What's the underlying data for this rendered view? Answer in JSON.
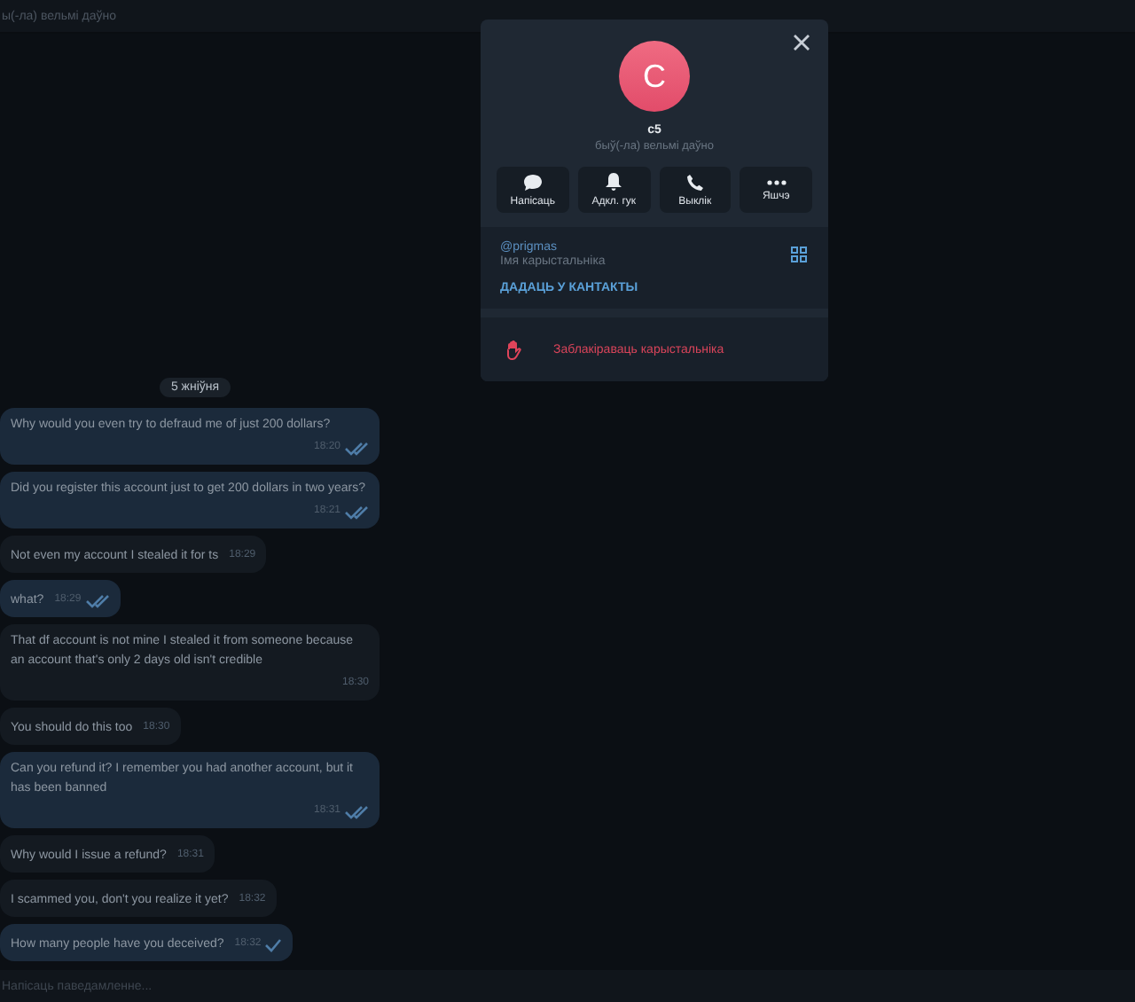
{
  "header": {
    "status": "ы(-ла) вельмі даўно"
  },
  "date_chip": "5 жніўня",
  "messages": [
    {
      "text": "Why would you even try to defraud me of just 200 dollars?",
      "time": "18:20",
      "outgoing": true,
      "read": true
    },
    {
      "text": "Did you register this account just to get 200 dollars in two years?",
      "time": "18:21",
      "outgoing": true,
      "read": true
    },
    {
      "text": "Not even my account I stealed it for ts",
      "time": "18:29",
      "outgoing": false
    },
    {
      "text": "what?",
      "time": "18:29",
      "outgoing": true,
      "read": true
    },
    {
      "text": "That df account is not mine I stealed it from someone because an account that's only 2 days old isn't credible",
      "time": "18:30",
      "outgoing": false
    },
    {
      "text": "You should do this too",
      "time": "18:30",
      "outgoing": false
    },
    {
      "text": "Can you refund it? I remember you had another account, but it has been banned",
      "time": "18:31",
      "outgoing": true,
      "read": true
    },
    {
      "text": "Why would I issue a refund?",
      "time": "18:31",
      "outgoing": false
    },
    {
      "text": "I scammed you, don't you realize it yet?",
      "time": "18:32",
      "outgoing": false
    },
    {
      "text": "How many people have you deceived?",
      "time": "18:32",
      "outgoing": true,
      "read": false
    }
  ],
  "composer": {
    "placeholder": "Напісаць паведамленне..."
  },
  "profile": {
    "avatar_letter": "C",
    "name": "c5",
    "status": "быў(-ла) вельмі даўно",
    "actions": [
      {
        "kind": "message",
        "label": "Напісаць"
      },
      {
        "kind": "bell",
        "label": "Адкл. гук"
      },
      {
        "kind": "call",
        "label": "Выклік"
      },
      {
        "kind": "more",
        "label": "Яшчэ"
      }
    ],
    "username": "@prigmas",
    "username_caption": "Імя карыстальніка",
    "add_contact": "ДАДАЦЬ У КАНТАКТЫ",
    "block": "Заблакіраваць карыстальніка"
  }
}
